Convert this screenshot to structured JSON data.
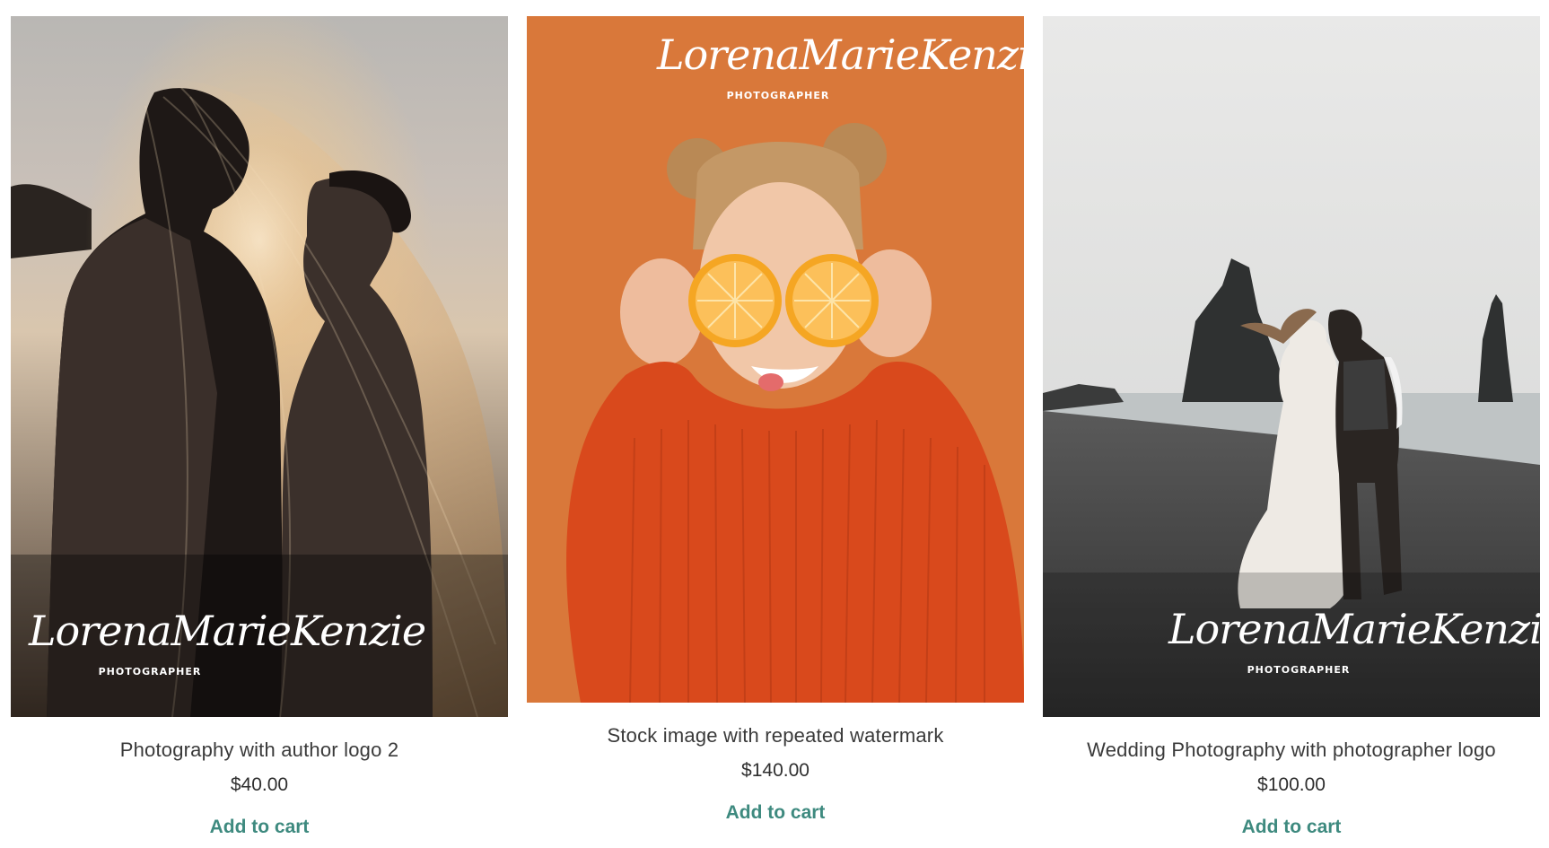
{
  "products": [
    {
      "title": "Photography with author logo 2",
      "price": "$40.00",
      "cta": "Add to cart",
      "watermark": {
        "logo": "LorenaMarieKenzie",
        "subtitle": "PHOTOGRAPHER"
      }
    },
    {
      "title": "Stock image with repeated watermark",
      "price": "$140.00",
      "cta": "Add to cart",
      "watermark": {
        "logo": "LorenaMarieKenzie",
        "subtitle": "PHOTOGRAPHER"
      }
    },
    {
      "title": "Wedding Photography with photographer logo",
      "price": "$100.00",
      "cta": "Add to cart",
      "watermark": {
        "logo": "LorenaMarieKenzie",
        "subtitle": "PHOTOGRAPHER"
      }
    }
  ],
  "colors": {
    "cta": "#3e8a7f",
    "title": "#3a3a3a",
    "price": "#2f2f2f",
    "orange_backdrop": "#d9783a",
    "sweater": "#d9491c"
  }
}
